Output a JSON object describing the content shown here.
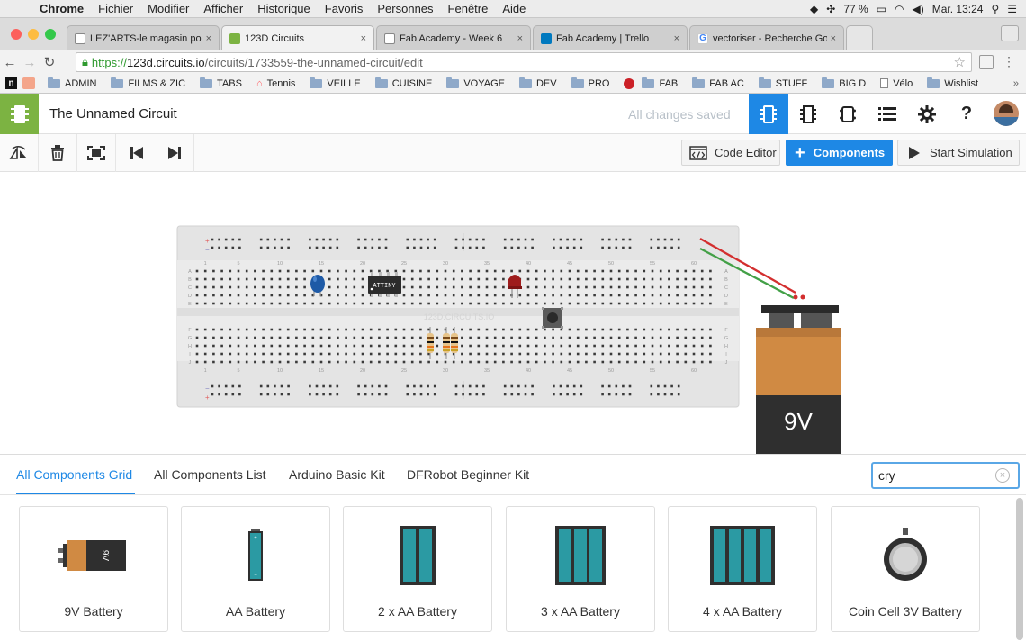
{
  "menubar": {
    "app": "Chrome",
    "items": [
      "Fichier",
      "Modifier",
      "Afficher",
      "Historique",
      "Favoris",
      "Personnes",
      "Fenêtre",
      "Aide"
    ],
    "battery": "77 %",
    "clock": "Mar. 13:24"
  },
  "tabs": [
    {
      "title": "LEZ'ARTS-le magasin pour",
      "active": false
    },
    {
      "title": "123D Circuits",
      "active": true
    },
    {
      "title": "Fab Academy - Week 6",
      "active": false
    },
    {
      "title": "Fab Academy | Trello",
      "active": false
    },
    {
      "title": "vectoriser - Recherche Goo",
      "active": false
    }
  ],
  "url": {
    "scheme": "https://",
    "host": "123d.circuits.io",
    "path": "/circuits/1733559-the-unnamed-circuit/edit"
  },
  "bookmarks": [
    "ADMIN",
    "FILMS & ZIC",
    "TABS",
    "Tennis",
    "VEILLE",
    "CUISINE",
    "VOYAGE",
    "DEV",
    "PRO",
    "FAB",
    "FAB AC",
    "STUFF",
    "BIG D",
    "Vélo",
    "Wishlist"
  ],
  "app": {
    "circuit_title": "The Unnamed Circuit",
    "save_status": "All changes saved"
  },
  "toolbar": {
    "code_editor": "Code Editor",
    "components": "Components",
    "start_simulation": "Start Simulation"
  },
  "breadboard": {
    "watermark": "123D.CIRCUITS.IO",
    "column_numbers": [
      "1",
      "5",
      "10",
      "15",
      "20",
      "25",
      "30",
      "35",
      "40",
      "45",
      "50",
      "55",
      "60"
    ],
    "rows_top": [
      "A",
      "B",
      "C",
      "D",
      "E"
    ],
    "rows_bottom": [
      "F",
      "G",
      "H",
      "I",
      "J"
    ],
    "chip_label": "ATTINY"
  },
  "battery_label": "9V",
  "panel": {
    "tabs": [
      "All Components Grid",
      "All Components List",
      "Arduino Basic Kit",
      "DFRobot Beginner Kit"
    ],
    "search_value": "cry",
    "cards": [
      {
        "label": "9V Battery",
        "icon": "9v-battery-icon"
      },
      {
        "label": "AA Battery",
        "icon": "aa-battery-icon"
      },
      {
        "label": "2 x AA Battery",
        "icon": "2xaa-battery-icon"
      },
      {
        "label": "3 x AA Battery",
        "icon": "3xaa-battery-icon"
      },
      {
        "label": "4 x AA Battery",
        "icon": "4xaa-battery-icon"
      },
      {
        "label": "Coin Cell 3V Battery",
        "icon": "coin-cell-battery-icon"
      }
    ]
  },
  "colors": {
    "accent": "#1e88e5",
    "logo": "#7cb342",
    "battery_copper": "#d08a43",
    "battery_body": "#2f2f2f",
    "cell_teal": "#2b9aa3",
    "wire_red": "#d32f2f",
    "wire_green": "#43a047"
  }
}
